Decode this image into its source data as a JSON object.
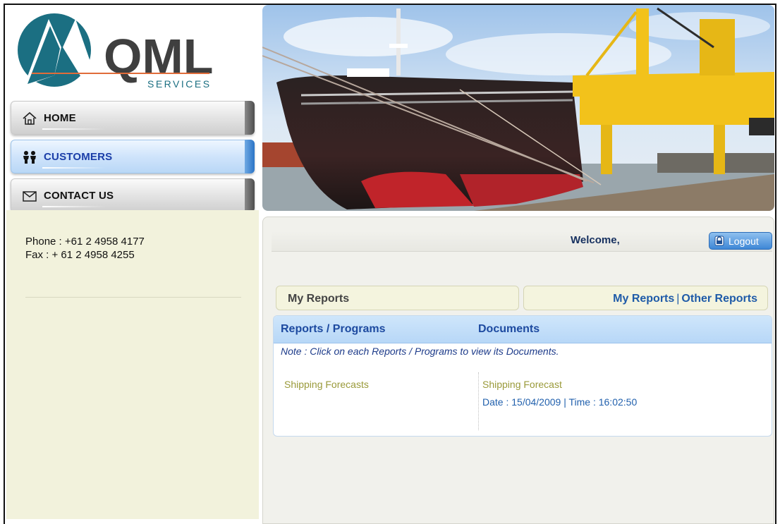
{
  "logo": {
    "text": "QML",
    "subtext": "SERVICES"
  },
  "nav": {
    "items": [
      {
        "label": "HOME",
        "icon": "house-icon"
      },
      {
        "label": "CUSTOMERS",
        "icon": "people-icon"
      },
      {
        "label": "CONTACT US",
        "icon": "envelope-icon"
      }
    ]
  },
  "contact": {
    "phone": "Phone : +61 2 4958 4177",
    "fax": "Fax : + 61 2 4958 4255"
  },
  "header": {
    "welcome": "Welcome,",
    "logout_label": "Logout"
  },
  "reports": {
    "section_title": "My Reports",
    "links": [
      "My Reports",
      "Other Reports"
    ],
    "link_separator": "|",
    "columns": [
      "Reports / Programs",
      "Documents"
    ],
    "note": "Note : Click on each Reports / Programs to view its Documents.",
    "rows": [
      {
        "program": "Shipping Forecasts",
        "document": "Shipping Forecast",
        "date_time": "Date : 15/04/2009  |  Time : 16:02:50"
      }
    ]
  },
  "colors": {
    "accent_blue": "#1f5ba8",
    "sidebar_bg": "#f2f2dc",
    "logo_teal": "#1b6f82",
    "link_olive": "#9a9a3a"
  }
}
